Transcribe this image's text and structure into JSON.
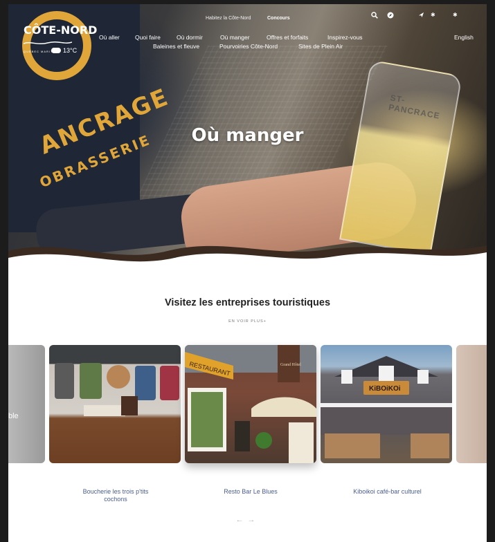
{
  "topbar": {
    "link1": "Habitez la Côte-Nord",
    "link2": "Concours",
    "icons": [
      "search-icon",
      "compass-icon",
      "plane-icon",
      "snowflake-icon",
      "snowflake-icon"
    ]
  },
  "logo": {
    "name": "CÔTE-NORD",
    "tagline": "QUÉBEC MARITIME"
  },
  "weather": {
    "temp": "13°C",
    "icon": "cloud-icon"
  },
  "nav": {
    "row1": [
      "Où aller",
      "Quoi faire",
      "Où dormir",
      "Où manger",
      "Offres et forfaits",
      "Inspirez-vous"
    ],
    "row2": [
      "Baleines et fleuve",
      "Pourvoiries Côte-Nord",
      "Sites de Plein Air"
    ],
    "language": "English"
  },
  "hero": {
    "title": "Où manger",
    "shirt_text": "ANCRAGE",
    "shirt_text2": "OBRASSERIE",
    "glass_text": "ST-PANCRACE"
  },
  "section": {
    "title": "Visitez les entreprises touristiques",
    "see_more": "EN VOIR PLUS+"
  },
  "cards": [
    {
      "partial_text": "ble",
      "caption": ""
    },
    {
      "caption": "Boucherie les trois p'tits cochons"
    },
    {
      "caption": "Resto Bar Le Blues"
    },
    {
      "caption": "Kiboikoi café-bar culturel"
    },
    {
      "caption": ""
    }
  ],
  "card_signs": {
    "c2_sign": "RESTAURANT",
    "c2_sign2": "Grand Hôtel",
    "c3_sign": "KiBOiKOi"
  },
  "carousel": {
    "prev": "←",
    "next": "→"
  },
  "colors": {
    "caption": "#4a5d8c",
    "shirt_text": "#e0a63a"
  }
}
